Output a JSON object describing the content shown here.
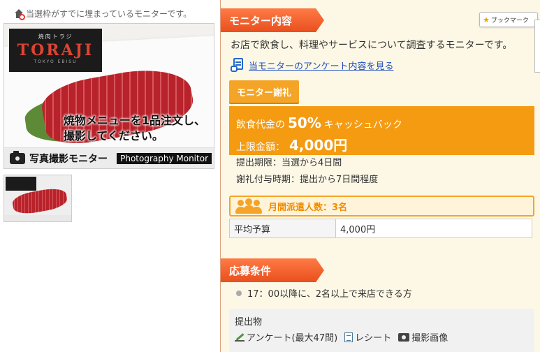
{
  "notice": {
    "text": "当選枠がすでに埋まっているモニターです。"
  },
  "photo": {
    "logo_small": "焼肉トラジ",
    "logo_big": "TORAJI",
    "logo_sub": "TOKYO EBISU",
    "caption_line1": "焼物メニューを1品注文し、",
    "caption_line2": "撮影してください。",
    "bar_label": "写真撮影モニター",
    "bar_label_en": "Photography Monitor"
  },
  "section_monitor": {
    "title": "モニター内容",
    "description": "お店で飲食し、料理やサービスについて調査するモニターです。",
    "survey_link": "当モニターのアンケート内容を見る"
  },
  "bookmark": {
    "label": "ブックマーク"
  },
  "reward": {
    "tab_label": "モニター謝礼",
    "cashback_prefix": "飲食代金の",
    "cashback_percent": "50%",
    "cashback_suffix": "キャッシュバック",
    "limit_label": "上限金額：",
    "limit_amount": "4,000円",
    "deadline": "提出期限：当選から4日間",
    "payment_timing": "謝礼付与時期：提出から7日間程度"
  },
  "dispatch": {
    "text": "月間派遣人数：3名"
  },
  "budget": {
    "label": "平均予算",
    "value": "4,000円"
  },
  "section_conditions": {
    "title": "応募条件",
    "condition": "17：00以降に、2名以上で来店できる方"
  },
  "submission": {
    "title": "提出物",
    "items": [
      "アンケート(最大47問)",
      "レシート",
      "撮影画像"
    ]
  },
  "colors": {
    "header_orange": "#e8501e",
    "reward_orange": "#f49b12",
    "link_blue": "#1f4fbf",
    "panel_bg": "#fdf8e6"
  }
}
